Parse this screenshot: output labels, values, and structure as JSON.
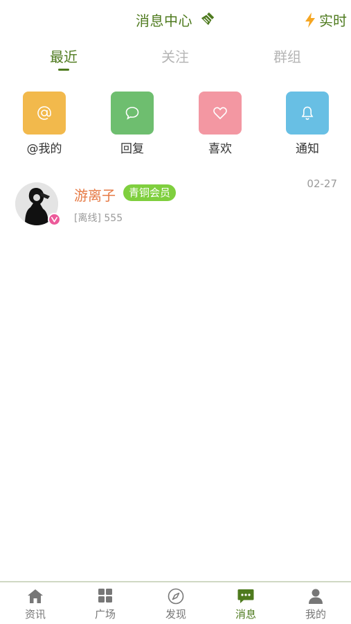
{
  "header": {
    "title": "消息中心",
    "realtime_label": "实时"
  },
  "tabs": [
    {
      "label": "最近",
      "active": true
    },
    {
      "label": "关注",
      "active": false
    },
    {
      "label": "群组",
      "active": false
    }
  ],
  "categories": [
    {
      "label": "@我的",
      "icon": "at-icon",
      "color": "#f2b94c"
    },
    {
      "label": "回复",
      "icon": "chat-bubble-icon",
      "color": "#6ebe6f"
    },
    {
      "label": "喜欢",
      "icon": "heart-icon",
      "color": "#f397a2"
    },
    {
      "label": "通知",
      "icon": "bell-icon",
      "color": "#68bfe4"
    }
  ],
  "messages": [
    {
      "name": "游离子",
      "badge": "青铜会员",
      "date": "02-27",
      "preview": "[离线] 555",
      "verified": true
    }
  ],
  "bottom_nav": [
    {
      "label": "资讯",
      "icon": "home-icon",
      "active": false
    },
    {
      "label": "广场",
      "icon": "grid-icon",
      "active": false
    },
    {
      "label": "发现",
      "icon": "compass-icon",
      "active": false
    },
    {
      "label": "消息",
      "icon": "message-icon",
      "active": true
    },
    {
      "label": "我的",
      "icon": "user-icon",
      "active": false
    }
  ],
  "colors": {
    "accent": "#4e7a1e",
    "member_badge": "#7fcf3e",
    "name": "#e67a45"
  }
}
